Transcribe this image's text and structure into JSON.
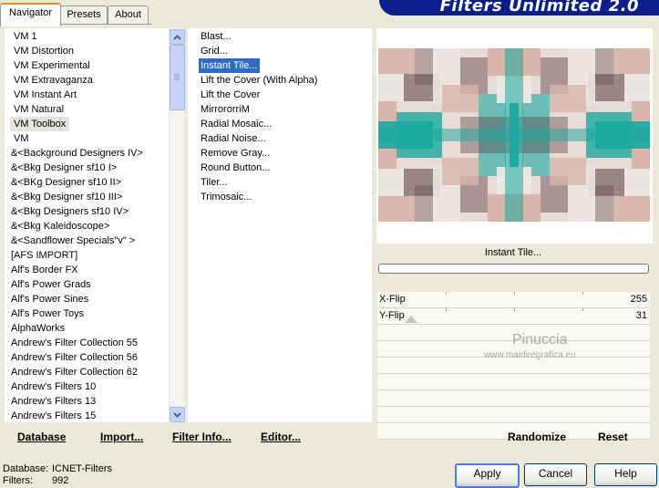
{
  "tabs": [
    {
      "label": "Navigator"
    },
    {
      "label": "Presets"
    },
    {
      "label": "About"
    }
  ],
  "banner": {
    "title": "Filters Unlimited 2.0"
  },
  "categories": [
    "VM 1",
    "VM Distortion",
    "VM Experimental",
    "VM Extravaganza",
    "VM Instant Art",
    "VM Natural",
    "VM Toolbox",
    "VM",
    "&<Background Designers IV>",
    "&<Bkg Designer sf10 I>",
    "&<BKg Designer sf10 II>",
    "&<Bkg Designer sf10 III>",
    "&<Bkg Designers sf10 IV>",
    "&<Bkg Kaleidoscope>",
    "&<Sandflower Specials\"v\" >",
    "[AFS IMPORT]",
    "Alf's Border FX",
    "Alf's Power Grads",
    "Alf's Power Sines",
    "Alf's Power Toys",
    "AlphaWorks",
    "Andrew's Filter Collection 55",
    "Andrew's Filter Collection 56",
    "Andrew's Filter Collection 62",
    "Andrew's Filters 10",
    "Andrew's Filters 13",
    "Andrew's Filters 15"
  ],
  "filters": [
    "Blast...",
    "Grid...",
    "Instant Tile...",
    "Lift the Cover (With Alpha)",
    "Lift the Cover",
    "MirrororriM",
    "Radial Mosaic...",
    "Radial Noise...",
    "Remove Gray...",
    "Round Button...",
    "Tiler...",
    "Trimosaic..."
  ],
  "preview": {
    "filter_name": "Instant Tile...",
    "colors": {
      "teal": "#1aa9a0",
      "pink": "#d8b4aa",
      "dark": "#5b3f45",
      "light": "#ece6e2"
    }
  },
  "params": [
    {
      "label": "X-Flip",
      "value": "255"
    },
    {
      "label": "Y-Flip",
      "value": "31"
    }
  ],
  "watermark": {
    "name": "Pinuccia",
    "site": "www.maidiregrafica.eu"
  },
  "left_links": {
    "database": "Database",
    "import": "Import...",
    "filter_info": "Filter Info...",
    "editor": "Editor..."
  },
  "right_links": {
    "randomize": "Randomize",
    "reset": "Reset"
  },
  "status": {
    "database_label": "Database:",
    "database_value": "ICNET-Filters",
    "filters_label": "Filters:",
    "filters_value": "992"
  },
  "buttons": {
    "apply": "Apply",
    "cancel": "Cancel",
    "help": "Help"
  }
}
